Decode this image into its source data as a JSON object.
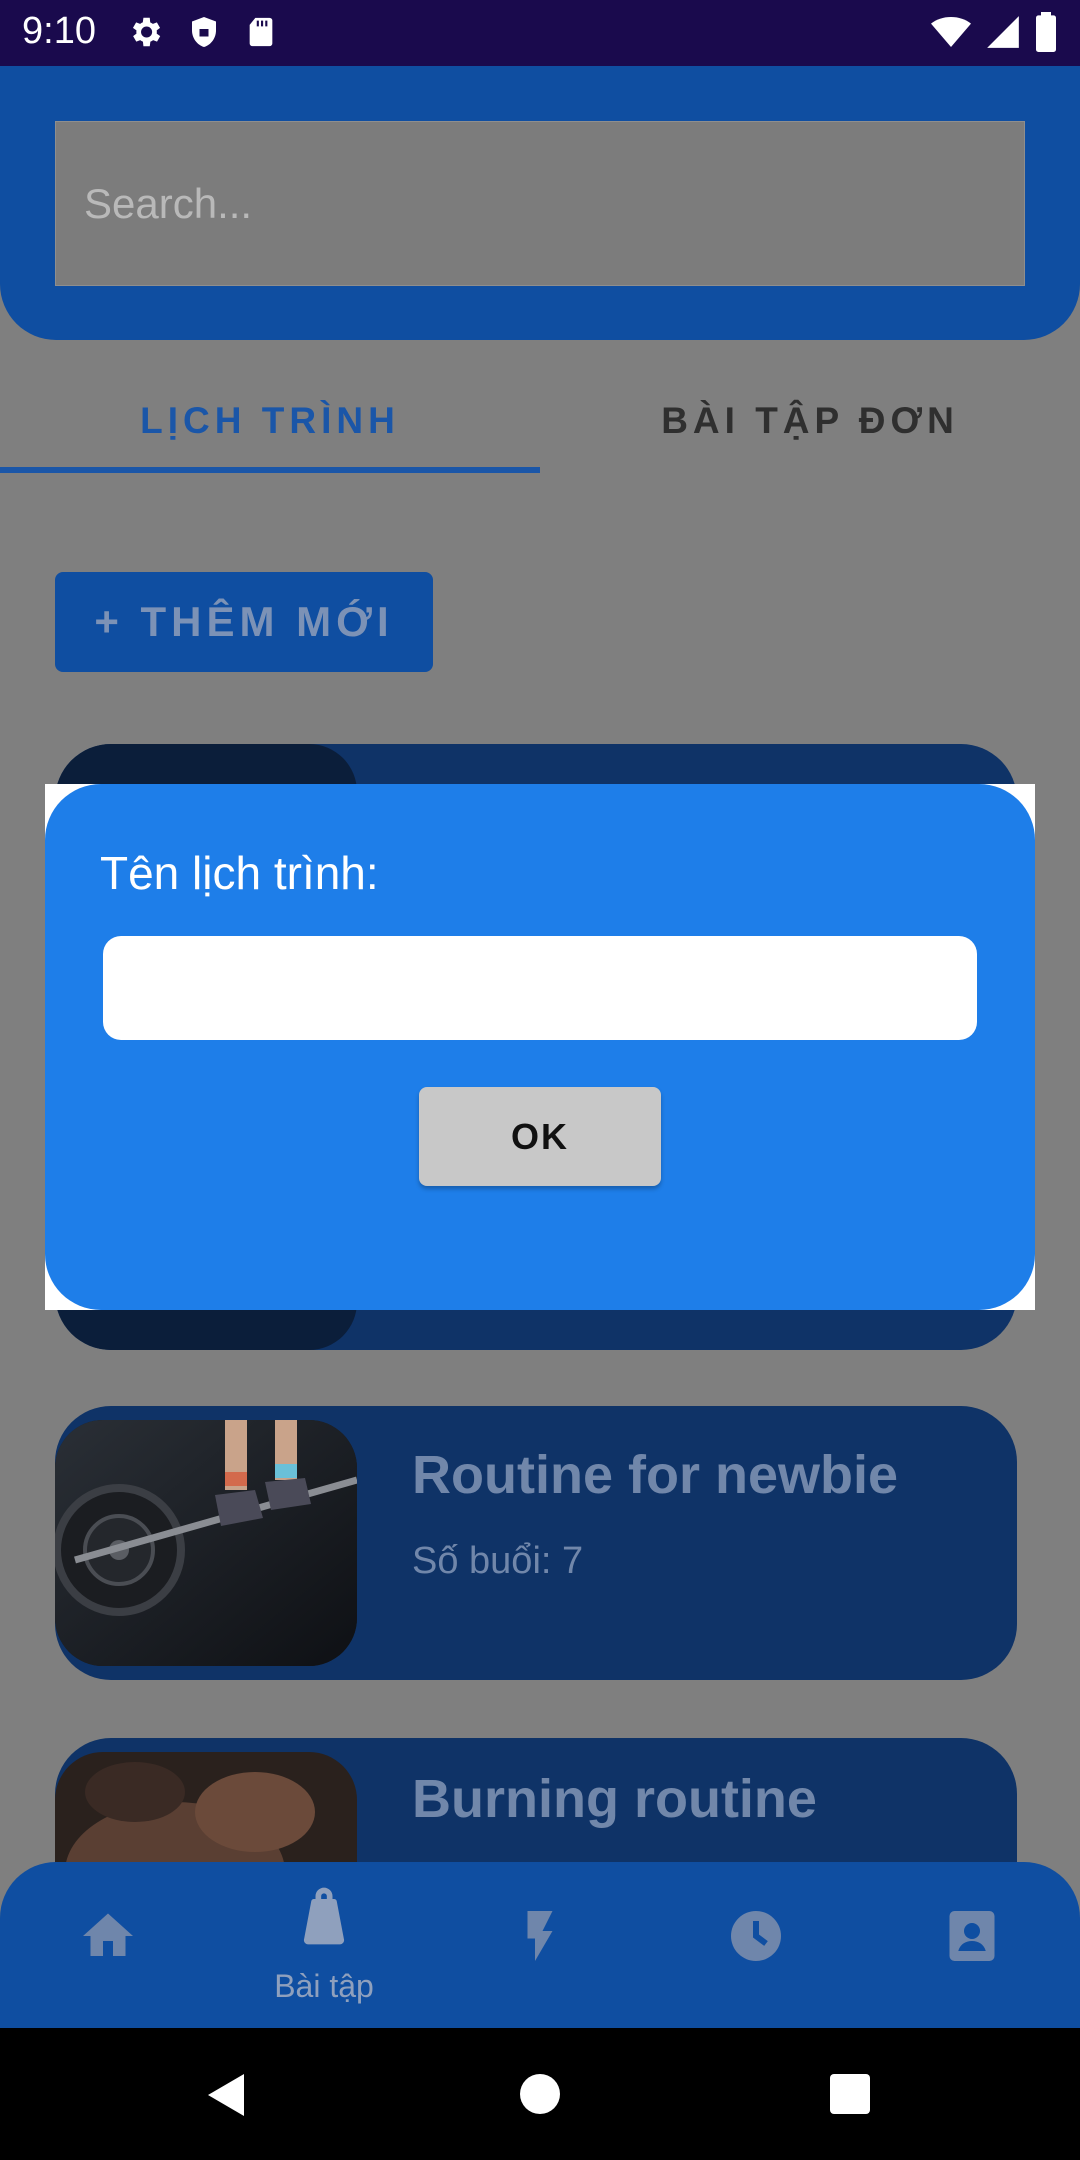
{
  "status_bar": {
    "time": "9:10",
    "left_icons": [
      "settings-icon",
      "shield-icon",
      "sd-card-icon"
    ],
    "right_icons": [
      "wifi-icon",
      "signal-icon",
      "battery-icon"
    ]
  },
  "search": {
    "placeholder": "Search..."
  },
  "tabs": [
    {
      "label": "LỊCH TRÌNH",
      "active": true
    },
    {
      "label": "BÀI TẬP ĐƠN",
      "active": false
    }
  ],
  "add_button": {
    "label": "+ THÊM MỚI"
  },
  "routines": [
    {
      "title": "Routine for newbie",
      "sessions": "Số buổi: 7",
      "image": "barbell-deadlift-photo"
    },
    {
      "title": "Burning routine",
      "image": "shoulder-back-photo"
    }
  ],
  "bottom_nav": [
    {
      "icon": "home-icon",
      "label": ""
    },
    {
      "icon": "kettlebell-icon",
      "label": "Bài tập",
      "active": true
    },
    {
      "icon": "lightning-icon",
      "label": ""
    },
    {
      "icon": "clock-icon",
      "label": ""
    },
    {
      "icon": "profile-icon",
      "label": ""
    }
  ],
  "dialog": {
    "title": "Tên lịch trình:",
    "input_value": "",
    "ok_label": "OK"
  },
  "colors": {
    "header_blue": "#0f4ea1",
    "dialog_blue": "#1e7ee9",
    "status_bar": "#1a0a4d"
  }
}
